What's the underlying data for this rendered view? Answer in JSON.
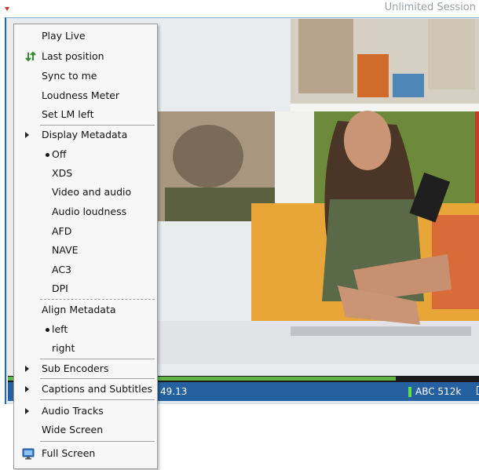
{
  "header": {
    "session_label": "Unlimited Session"
  },
  "status_bar": {
    "timecode": "49.13",
    "channel_bitrate": "ABC 512k"
  },
  "progress": {
    "fraction": 0.82
  },
  "menu": {
    "play_live": "Play Live",
    "last_position": "Last position",
    "sync_to_me": "Sync to me",
    "loudness_meter": "Loudness Meter",
    "set_lm_left": "Set LM left",
    "display_metadata": {
      "label": "Display Metadata",
      "options": [
        "Off",
        "XDS",
        "Video and audio",
        "Audio loudness",
        "AFD",
        "NAVE",
        "AC3",
        "DPI"
      ],
      "selected": "Off"
    },
    "align_metadata": {
      "label": "Align Metadata",
      "options": [
        "left",
        "right"
      ],
      "selected": "left"
    },
    "sub_encoders": "Sub Encoders",
    "captions_and_subtitles": "Captions and Subtitles",
    "audio_tracks": "Audio Tracks",
    "wide_screen": "Wide Screen",
    "full_screen": "Full Screen"
  }
}
